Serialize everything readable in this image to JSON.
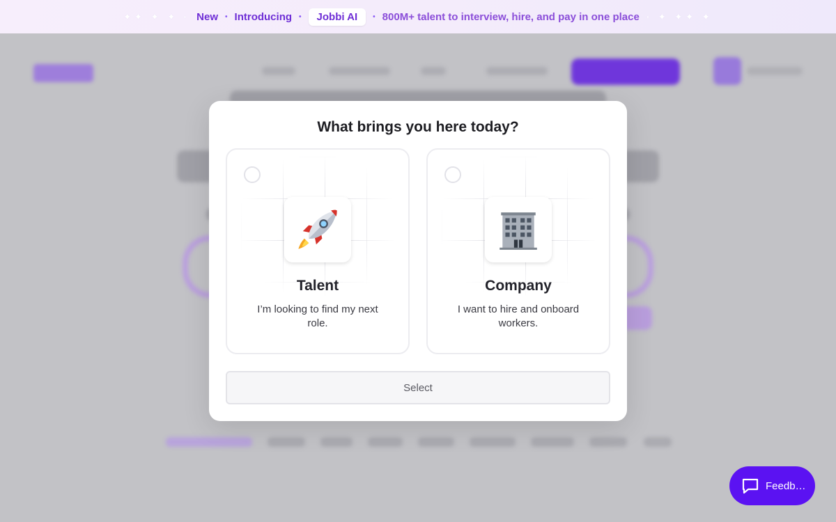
{
  "banner": {
    "new_label": "New",
    "introducing_label": "Introducing",
    "product_label": "Jobbi AI",
    "tagline": "800M+ talent to interview, hire, and pay in one place"
  },
  "modal": {
    "title": "What brings you here today?",
    "options": [
      {
        "title": "Talent",
        "description": "I’m looking to find my next role.",
        "icon": "rocket-icon"
      },
      {
        "title": "Company",
        "description": "I want to hire and onboard workers.",
        "icon": "office-building-icon"
      }
    ],
    "select_label": "Select"
  },
  "feedback": {
    "label": "Feedb…"
  },
  "colors": {
    "brand": "#5b12f2",
    "banner_text": "#6f2fd6"
  }
}
